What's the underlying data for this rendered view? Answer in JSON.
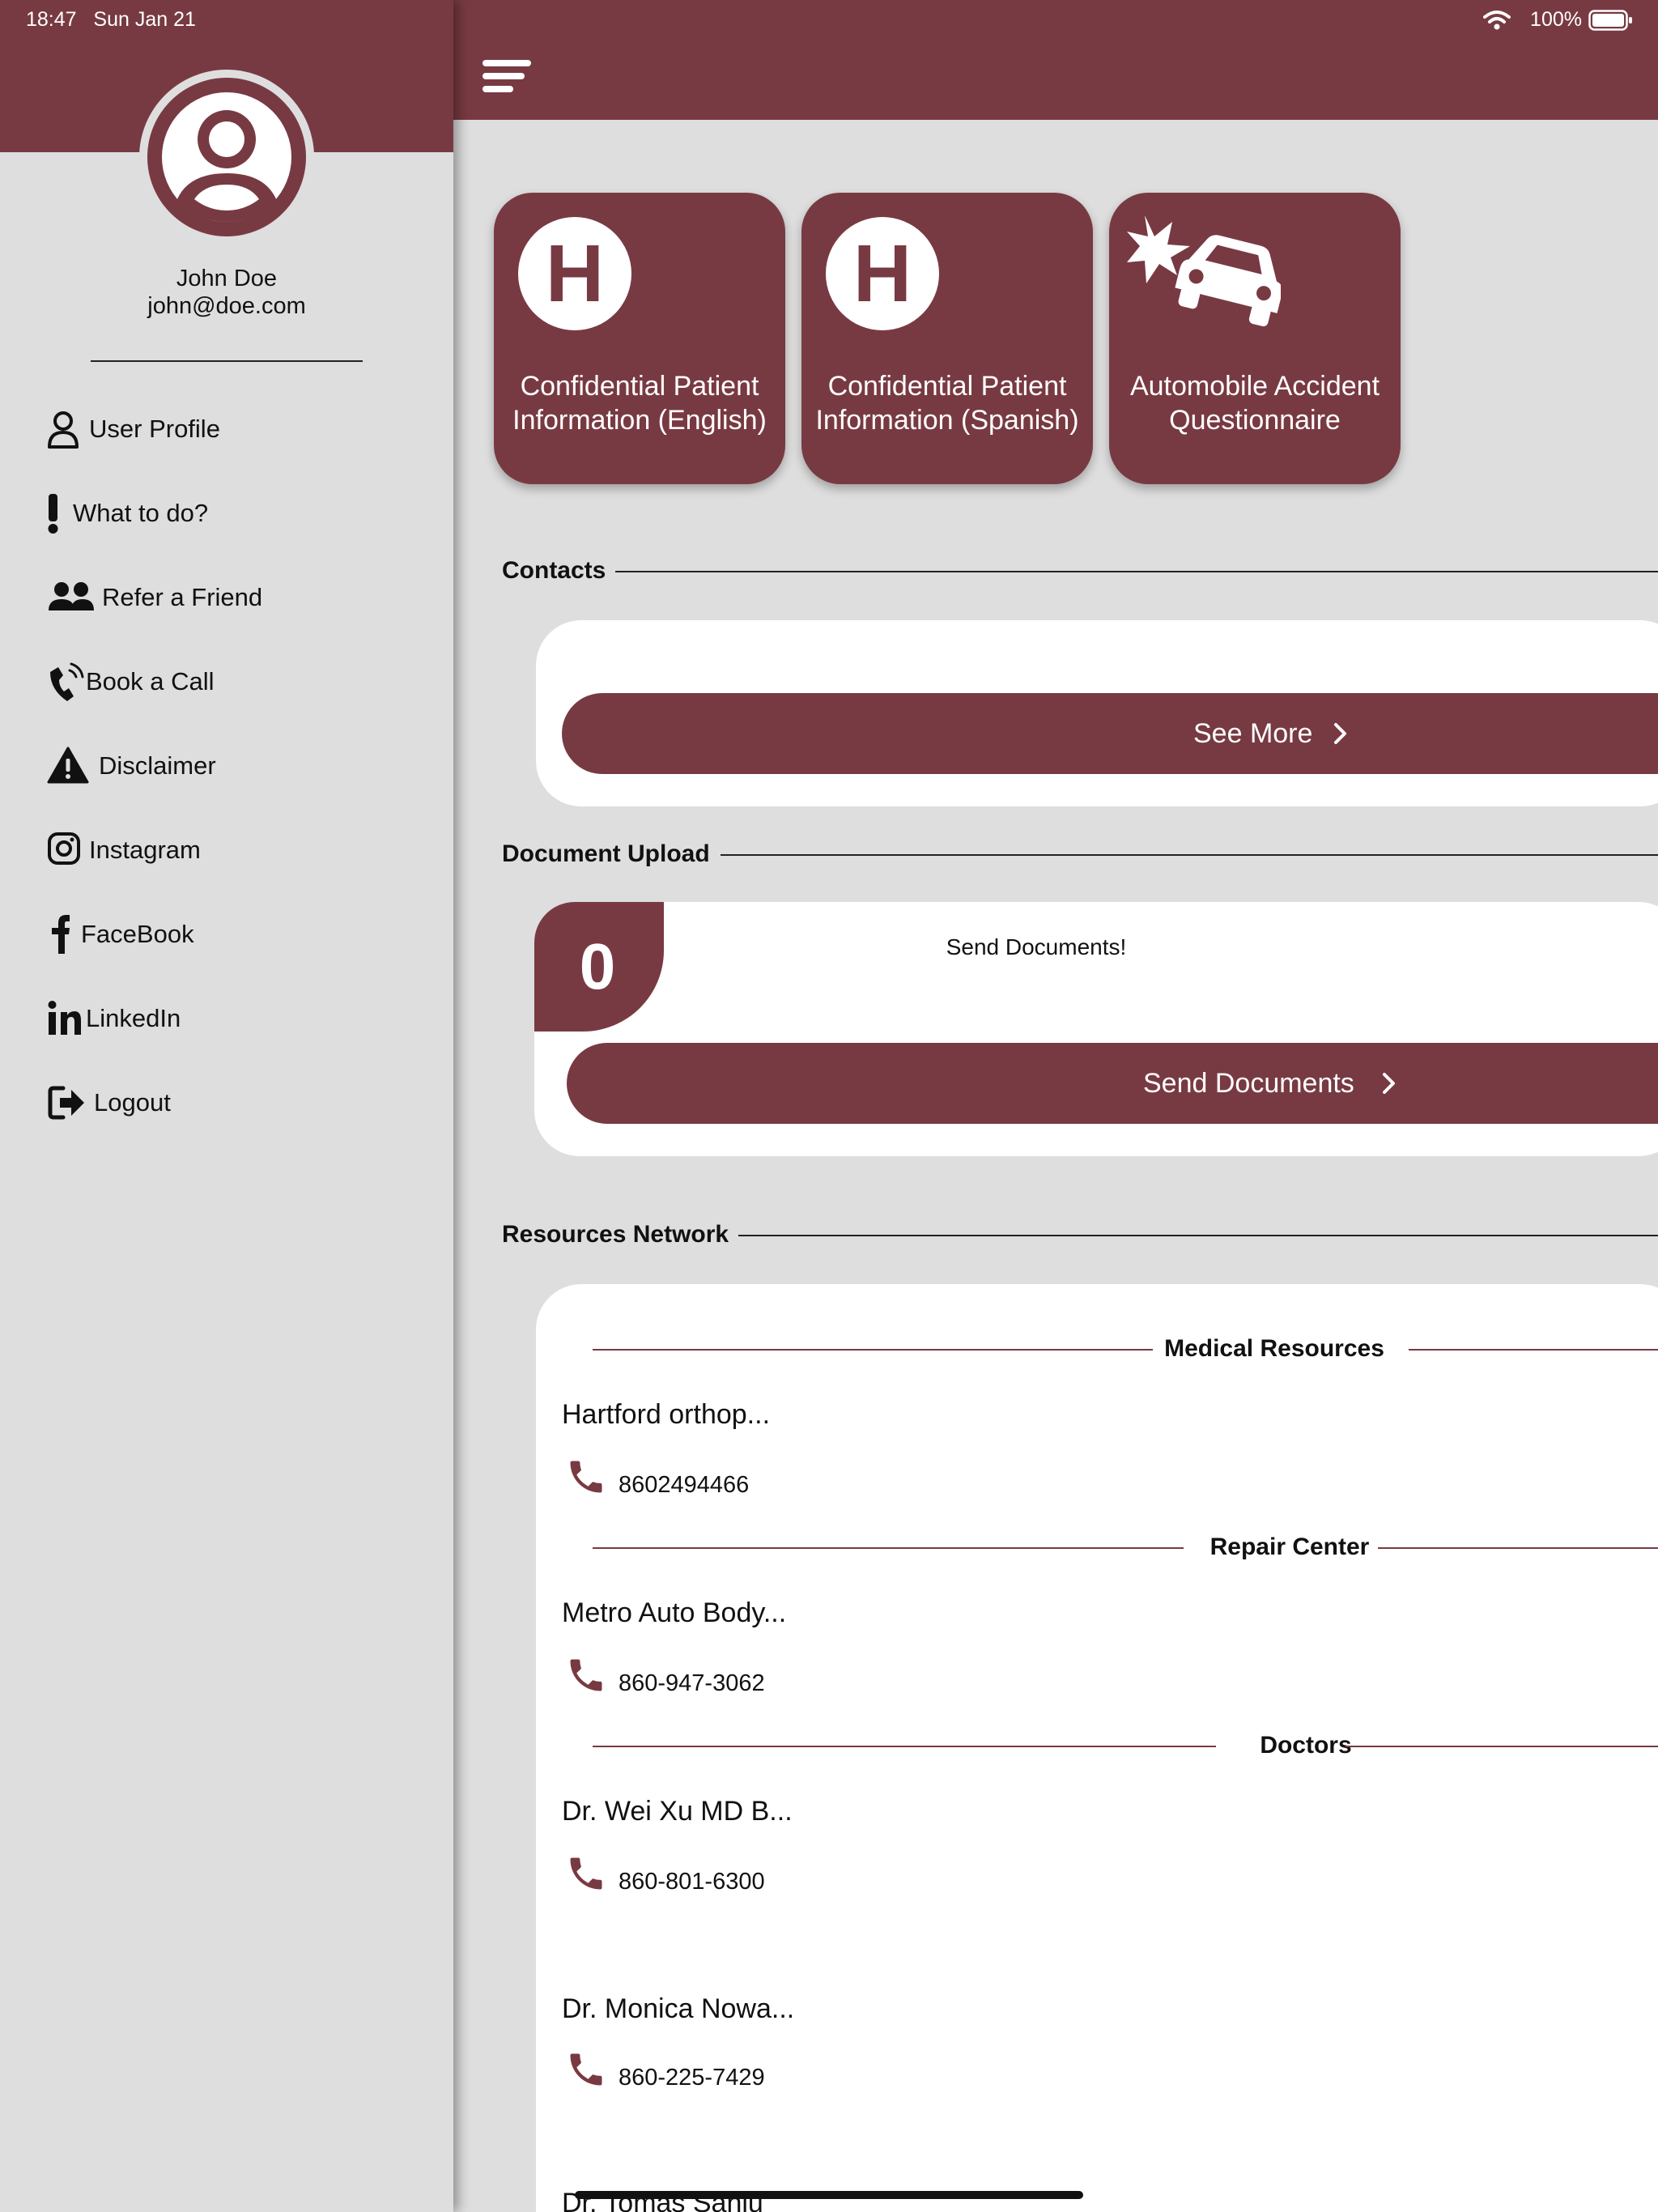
{
  "status_bar": {
    "time": "18:47",
    "date": "Sun Jan 21",
    "battery": "100%"
  },
  "theme": {
    "accent": "#783a42",
    "background": "#dedede",
    "card": "#ffffff"
  },
  "user": {
    "name": "John Doe",
    "email": "john@doe.com"
  },
  "sidebar": {
    "items": [
      {
        "label": "User Profile",
        "icon": "user-icon"
      },
      {
        "label": "What to do?",
        "icon": "exclamation-icon"
      },
      {
        "label": "Refer a Friend",
        "icon": "users-icon"
      },
      {
        "label": "Book a Call",
        "icon": "phone-call-icon"
      },
      {
        "label": "Disclaimer",
        "icon": "warning-icon"
      },
      {
        "label": "Instagram",
        "icon": "instagram-icon"
      },
      {
        "label": "FaceBook",
        "icon": "facebook-icon"
      },
      {
        "label": "LinkedIn",
        "icon": "linkedin-icon"
      },
      {
        "label": "Logout",
        "icon": "logout-icon"
      }
    ]
  },
  "header": {
    "menu_icon": "hamburger-menu-icon"
  },
  "tiles": [
    {
      "icon_letter": "H",
      "label_line1": "Confidential Patient",
      "label_line2": "Information (English)"
    },
    {
      "icon_letter": "H",
      "label_line1": "Confidential Patient",
      "label_line2": "Information (Spanish)"
    },
    {
      "icon": "car-crash-icon",
      "label_line1": "Automobile Accident",
      "label_line2": "Questionnaire"
    }
  ],
  "contacts": {
    "title": "Contacts",
    "button_label": "See More"
  },
  "document_upload": {
    "title": "Document Upload",
    "count": "0",
    "message": "Send Documents!",
    "button_label": "Send Documents"
  },
  "resources": {
    "title": "Resources Network",
    "groups": [
      {
        "heading": "Medical Resources",
        "entries": [
          {
            "name": "Hartford orthop...",
            "phone": "8602494466"
          }
        ]
      },
      {
        "heading": "Repair Center",
        "entries": [
          {
            "name": "Metro Auto Body...",
            "phone": "860-947-3062"
          }
        ]
      },
      {
        "heading": "Doctors",
        "entries": [
          {
            "name": "Dr. Wei Xu MD B...",
            "phone": "860-801-6300"
          },
          {
            "name": "Dr. Monica Nowa...",
            "phone": "860-225-7429"
          },
          {
            "name": "Dr. Tomas Sanju"
          }
        ]
      }
    ]
  }
}
